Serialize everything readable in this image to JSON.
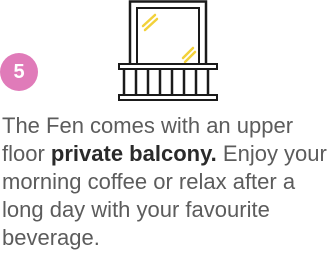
{
  "badge": {
    "number": "5",
    "color": "#e07bb9"
  },
  "illustration": {
    "icon": "balcony-icon",
    "accent_color": "#f2d13a",
    "line_color": "#1a1a1a"
  },
  "description": {
    "text_before": "The Fen comes with an upper floor ",
    "highlight": "private balcony.",
    "text_after": " Enjoy your morning coffee or relax after a long day with your favourite beverage."
  }
}
